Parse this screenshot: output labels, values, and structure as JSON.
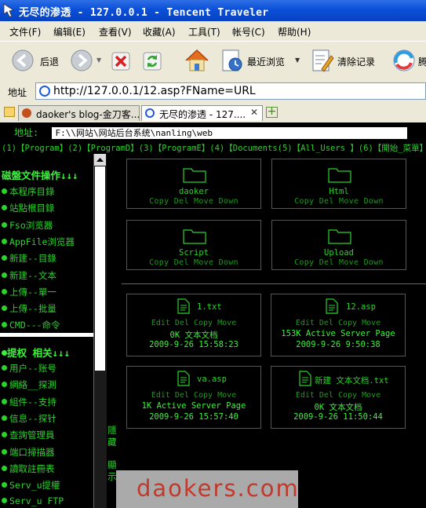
{
  "window": {
    "title": "无尽的渗透 - 127.0.0.1 - Tencent Traveler"
  },
  "menu": [
    "文件(F)",
    "编辑(E)",
    "查看(V)",
    "收藏(A)",
    "工具(T)",
    "帐号(C)",
    "帮助(H)"
  ],
  "toolbar": {
    "back": "后退",
    "recent": "最近浏览",
    "clear": "清除记录",
    "extra": "腾"
  },
  "address": {
    "label": "地址",
    "url": "http://127.0.0.1/12.asp?FName=URL"
  },
  "tabs": [
    {
      "title": "daoker's blog-金刀客...",
      "active": false
    },
    {
      "title": "无尽的渗透 - 127....",
      "active": true
    }
  ],
  "shell": {
    "path_label": "地址:",
    "path_value": "F:\\\\网站\\网站后台系统\\nanling\\web",
    "tasks": "(1)【Program】(2)【ProgramD】(3)【ProgramE】(4)【Documents(5)【All_Users 】(6)【開始_菜單】",
    "section1_title": "磁盤文件操作↓↓↓",
    "section1_items": [
      "本程序目錄",
      "站點根目錄",
      "Fso浏览器",
      "AppFile浏览器",
      "新建--目錄",
      "新建--文本",
      "上傳--單一",
      "上傳--批量",
      "CMD---命令"
    ],
    "section2_title": "提权 相关↓↓↓",
    "section2_items": [
      "用户--账号",
      "網絡__探測",
      "組件--支持",
      "信息--探针",
      "查詢管理員",
      "端口掃描器",
      "讀取註冊表",
      "Serv_u提權",
      "Serv_u FTP"
    ],
    "hide_label": "隱藏",
    "show_label": "顯示",
    "folders": [
      {
        "name": "daoker",
        "actions": "Copy Del Move Down"
      },
      {
        "name": "Html",
        "actions": "Copy Del Move Down"
      },
      {
        "name": "Script",
        "actions": "Copy Del Move Down"
      },
      {
        "name": "Upload",
        "actions": "Copy Del Move Down"
      }
    ],
    "files": [
      {
        "name": "1.txt",
        "actions": "Edit Del Copy Move",
        "type": "0K 文本文档",
        "date": "2009-9-26 15:58:23"
      },
      {
        "name": "12.asp",
        "actions": "Edit Del Copy Move",
        "type": "153K Active Server Page",
        "date": "2009-9-26 9:50:38"
      },
      {
        "name": "va.asp",
        "actions": "Edit Del Copy Move",
        "type": "1K Active Server Page",
        "date": "2009-9-26 15:57:40"
      },
      {
        "name": "新建 文本文档.txt",
        "actions": "Edit Del Copy Move",
        "type": "0K 文本文档",
        "date": "2009-9-26 11:50:44"
      }
    ]
  },
  "watermark": "daokers.com"
}
